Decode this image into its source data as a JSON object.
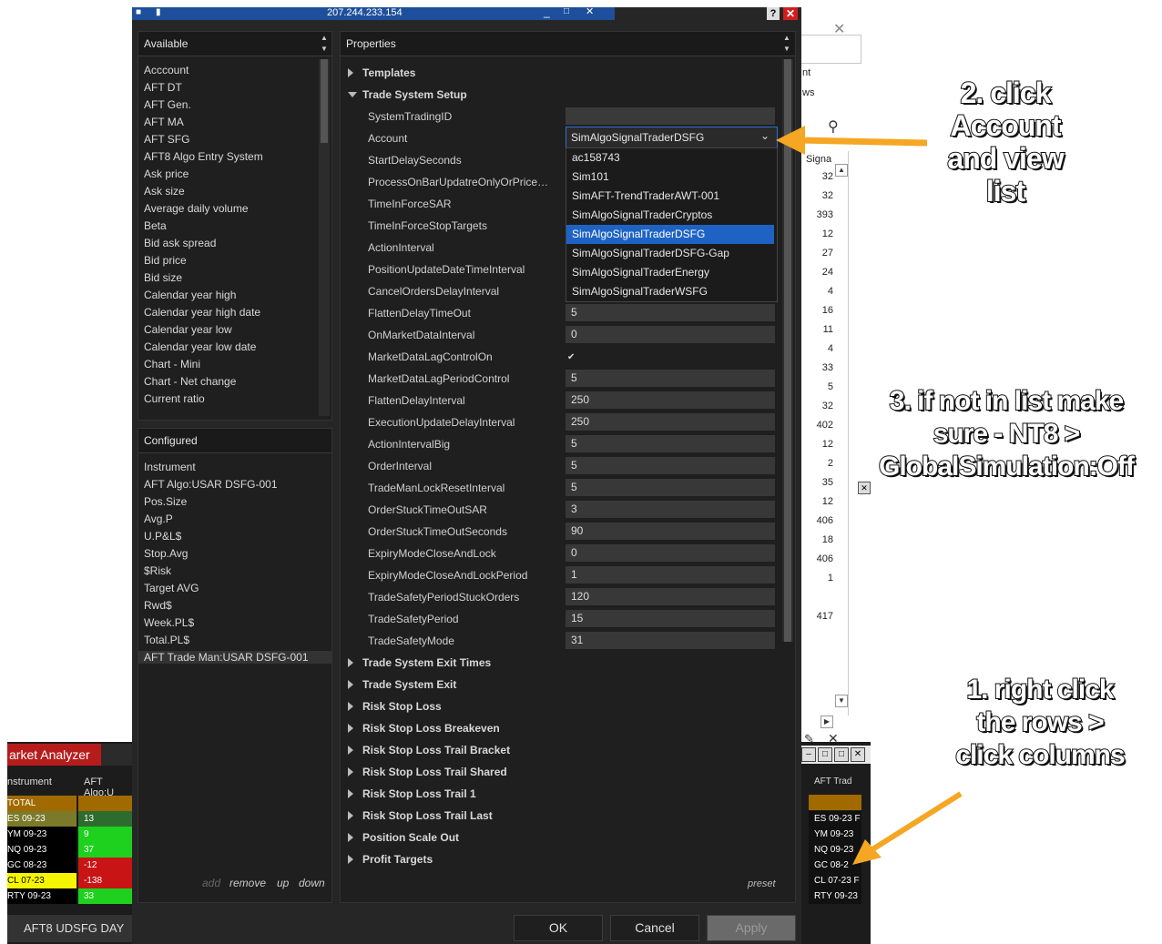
{
  "window": {
    "title": "207.244.233.154"
  },
  "available": {
    "header": "Available",
    "items": [
      "Acccount",
      "AFT DT",
      "AFT Gen.",
      "AFT MA",
      "AFT SFG",
      "AFT8 Algo Entry System",
      "Ask price",
      "Ask size",
      "Average daily volume",
      "Beta",
      "Bid ask spread",
      "Bid price",
      "Bid size",
      "Calendar year high",
      "Calendar year high date",
      "Calendar year low",
      "Calendar year low date",
      "Chart - Mini",
      "Chart - Net change",
      "Current ratio"
    ]
  },
  "configured": {
    "header": "Configured",
    "items": [
      "Instrument",
      "AFT Algo:USAR DSFG-001",
      "Pos.Size",
      "Avg.P",
      "U.P&L$",
      "Stop.Avg",
      "$Risk",
      "Target AVG",
      "Rwd$",
      "Week.PL$",
      "Total.PL$",
      "AFT Trade Man:USAR DSFG-001"
    ],
    "selected_index": 11
  },
  "list_actions": {
    "add": "add",
    "remove": "remove",
    "up": "up",
    "down": "down"
  },
  "properties": {
    "header": "Properties",
    "categories_top": [
      {
        "label": "Templates",
        "expanded": false
      },
      {
        "label": "Trade System Setup",
        "expanded": true
      }
    ],
    "fields": [
      {
        "label": "SystemTradingID",
        "value": ""
      },
      {
        "label": "Account",
        "value": "SimAlgoSignalTraderDSFG"
      },
      {
        "label": "StartDelaySeconds",
        "value": ""
      },
      {
        "label": "ProcessOnBarUpdatreOnlyOrPrice…",
        "value": ""
      },
      {
        "label": "TimeInForceSAR",
        "value": ""
      },
      {
        "label": "TimeInForceStopTargets",
        "value": ""
      },
      {
        "label": "ActionInterval",
        "value": ""
      },
      {
        "label": "PositionUpdateDateTimeInterval",
        "value": ""
      },
      {
        "label": "CancelOrdersDelayInterval",
        "value": ""
      },
      {
        "label": "FlattenDelayTimeOut",
        "value": "5"
      },
      {
        "label": "OnMarketDataInterval",
        "value": "0"
      },
      {
        "label": "MarketDataLagControlOn",
        "value": ""
      },
      {
        "label": "MarketDataLagPeriodControl",
        "value": "5"
      },
      {
        "label": "FlattenDelayInterval",
        "value": "250"
      },
      {
        "label": "ExecutionUpdateDelayInterval",
        "value": "250"
      },
      {
        "label": "ActionIntervalBig",
        "value": "5"
      },
      {
        "label": "OrderInterval",
        "value": "5"
      },
      {
        "label": "TradeManLockResetInterval",
        "value": "5"
      },
      {
        "label": "OrderStuckTimeOutSAR",
        "value": "3"
      },
      {
        "label": "OrderStuckTimeOutSeconds",
        "value": "90"
      },
      {
        "label": "ExpiryModeCloseAndLock",
        "value": "0"
      },
      {
        "label": "ExpiryModeCloseAndLockPeriod",
        "value": "1"
      },
      {
        "label": "TradeSafetyPeriodStuckOrders",
        "value": "120"
      },
      {
        "label": "TradeSafetyPeriod",
        "value": "15"
      },
      {
        "label": "TradeSafetyMode",
        "value": "31"
      }
    ],
    "market_data_lag_checked": true,
    "categories_bottom": [
      "Trade System Exit Times",
      "Trade System Exit",
      "Risk Stop Loss",
      "Risk Stop Loss Breakeven",
      "Risk Stop Loss Trail Bracket",
      "Risk Stop Loss Trail Shared",
      "Risk Stop Loss Trail 1",
      "Risk Stop Loss Trail Last",
      "Position Scale Out",
      "Profit Targets"
    ],
    "preset": "preset"
  },
  "account_dropdown": {
    "options": [
      "ac158743",
      "Sim101",
      "SimAFT-TrendTraderAWT-001",
      "SimAlgoSignalTraderCryptos",
      "SimAlgoSignalTraderDSFG",
      "SimAlgoSignalTraderDSFG-Gap",
      "SimAlgoSignalTraderEnergy",
      "SimAlgoSignalTraderWSFG"
    ],
    "selected_index": 4,
    "highlight_color": "#1e63c4"
  },
  "buttons": {
    "ok": "OK",
    "cancel": "Cancel",
    "apply": "Apply"
  },
  "market_analyzer": {
    "title": "arket Analyzer",
    "col_instrument": "nstrument",
    "col_algo": "AFT Algo:U",
    "rows": [
      {
        "inst": "TOTAL",
        "val": "",
        "inst_bg": "#a16a00",
        "val_bg": "#a16a00"
      },
      {
        "inst": "ES 09-23",
        "val": "13",
        "inst_bg": "#7a7a2a",
        "val_bg": "#2e6b2e"
      },
      {
        "inst": "YM 09-23",
        "val": "9",
        "inst_bg": "#000000",
        "val_bg": "#1fd11f"
      },
      {
        "inst": "NQ 09-23",
        "val": "37",
        "inst_bg": "#000000",
        "val_bg": "#1fd11f"
      },
      {
        "inst": "GC 08-23",
        "val": "-12",
        "inst_bg": "#000000",
        "val_bg": "#c81414"
      },
      {
        "inst": "CL 07-23",
        "val": "-138",
        "inst_bg": "#f5f500",
        "val_bg": "#c81414"
      },
      {
        "inst": "RTY 09-23",
        "val": "33",
        "inst_bg": "#000000",
        "val_bg": "#1fd11f"
      }
    ],
    "footer": "AFT8 UDSFG DAY"
  },
  "right_analyzer": {
    "col": "AFT Trad",
    "rows": [
      "ES 09-23 F",
      "YM 09-23 F",
      "NQ 09-23",
      "GC 08-2",
      "CL 07-23 F",
      "RTY 09-23"
    ]
  },
  "background_window": {
    "fragments": [
      "nt",
      "ws",
      "Signa"
    ],
    "values": [
      "32",
      "32",
      "393",
      "12",
      "27",
      "24",
      "4",
      "16",
      "11",
      "4",
      "33",
      "5",
      "32",
      "402",
      "12",
      "2",
      "35",
      "12",
      "406",
      "18",
      "406",
      "1",
      "",
      "417"
    ]
  },
  "annotations": {
    "step2": [
      "2. click",
      "Account",
      "and view",
      "list"
    ],
    "step3": [
      "3. if not in list make",
      "sure  - NT8 >",
      "GlobalSimulation:Off"
    ],
    "step1": [
      "1. right click",
      "the rows >",
      "click columns"
    ],
    "arrow_color": "#f5a623"
  }
}
